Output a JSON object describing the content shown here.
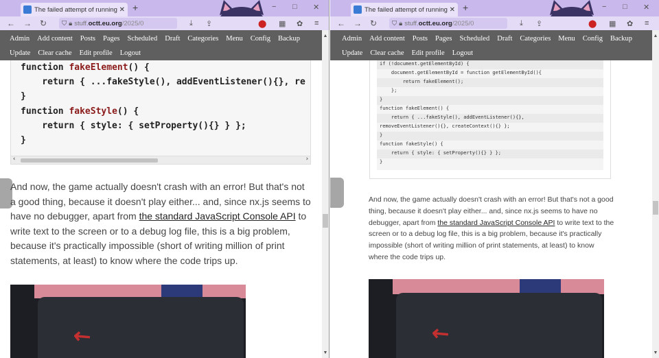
{
  "browser": {
    "tab_title": "The failed attempt of running H",
    "new_tab": "+",
    "url_domain": "stuff.",
    "url_domain_bold": "octt.eu.org",
    "url_path": "/2025/0",
    "controls": [
      "−",
      "□",
      "✕"
    ]
  },
  "adminbar": {
    "row1": [
      "Admin",
      "Add content",
      "Posts",
      "Pages",
      "Scheduled",
      "Draft",
      "Categories",
      "Menu",
      "Config",
      "Backup"
    ],
    "row2": [
      "Update",
      "Clear cache",
      "Edit profile",
      "Logout"
    ]
  },
  "left": {
    "code_lines": [
      {
        "kw": "function ",
        "fn": "fakeElement",
        "rest": "() {"
      },
      {
        "kw": "    return ",
        "fn": "",
        "rest": "{ ...fakeStyle(), addEventListener(){}, re"
      },
      {
        "kw": "",
        "fn": "",
        "rest": "}"
      },
      {
        "kw": "function ",
        "fn": "fakeStyle",
        "rest": "() {"
      },
      {
        "kw": "    return ",
        "fn": "",
        "rest": "{ style: { setProperty(){} } };"
      },
      {
        "kw": "",
        "fn": "",
        "rest": "}"
      }
    ]
  },
  "right": {
    "code_lines": [
      "if (!document.getElementById) {",
      "    document.getElementById = function getElementById(){",
      "        return fakeElement();",
      "    };",
      "}",
      "function fakeElement() {",
      "    return { ...fakeStyle(), addEventListener(){},",
      "removeEventListener(){}, createContext(){} };",
      "}",
      "function fakeStyle() {",
      "    return { style: { setProperty(){} } };",
      "}"
    ]
  },
  "article": {
    "p1": "And now, the game actually doesn't crash with an error! But that's not a good thing, because it doesn't play either... and, since nx.js seems to have no debugger, apart from ",
    "link": "the standard JavaScript Console API",
    "p2": " to write text to the screen or to a debug log file, this is a big problem, because it's practically impossible (short of writing million of print statements, at least) to know where the code trips up."
  },
  "colors": {
    "titlebar": "#c9b8ec",
    "adminbar": "#5f5f5f",
    "code_fn": "#8b1a1a"
  },
  "icons": [
    "back-icon",
    "forward-icon",
    "reload-icon",
    "shield-icon",
    "lock-icon",
    "download-icon",
    "share-icon",
    "cat-icon",
    "extension-icon",
    "qr-icon",
    "menu-icon"
  ]
}
